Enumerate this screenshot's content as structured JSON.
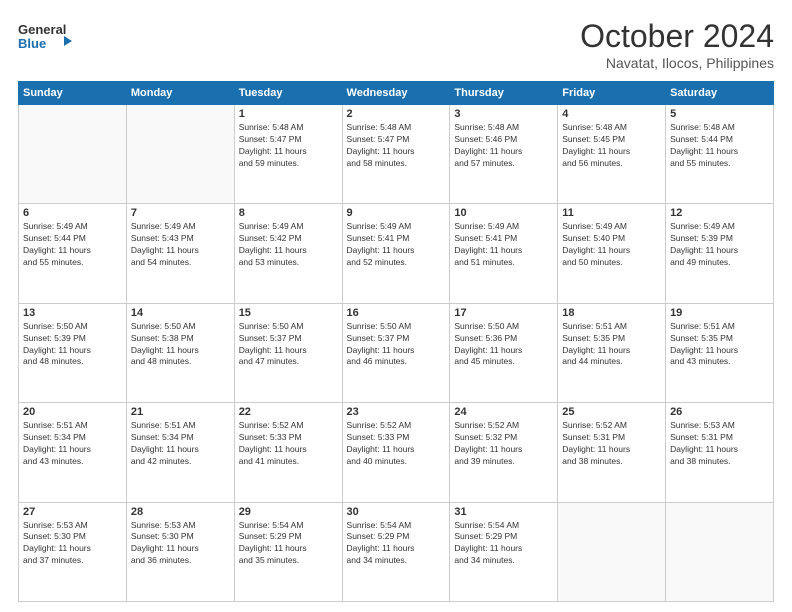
{
  "header": {
    "logo_line1": "General",
    "logo_line2": "Blue",
    "month": "October 2024",
    "location": "Navatat, Ilocos, Philippines"
  },
  "weekdays": [
    "Sunday",
    "Monday",
    "Tuesday",
    "Wednesday",
    "Thursday",
    "Friday",
    "Saturday"
  ],
  "weeks": [
    [
      {
        "day": "",
        "info": ""
      },
      {
        "day": "",
        "info": ""
      },
      {
        "day": "1",
        "info": "Sunrise: 5:48 AM\nSunset: 5:47 PM\nDaylight: 11 hours\nand 59 minutes."
      },
      {
        "day": "2",
        "info": "Sunrise: 5:48 AM\nSunset: 5:47 PM\nDaylight: 11 hours\nand 58 minutes."
      },
      {
        "day": "3",
        "info": "Sunrise: 5:48 AM\nSunset: 5:46 PM\nDaylight: 11 hours\nand 57 minutes."
      },
      {
        "day": "4",
        "info": "Sunrise: 5:48 AM\nSunset: 5:45 PM\nDaylight: 11 hours\nand 56 minutes."
      },
      {
        "day": "5",
        "info": "Sunrise: 5:48 AM\nSunset: 5:44 PM\nDaylight: 11 hours\nand 55 minutes."
      }
    ],
    [
      {
        "day": "6",
        "info": "Sunrise: 5:49 AM\nSunset: 5:44 PM\nDaylight: 11 hours\nand 55 minutes."
      },
      {
        "day": "7",
        "info": "Sunrise: 5:49 AM\nSunset: 5:43 PM\nDaylight: 11 hours\nand 54 minutes."
      },
      {
        "day": "8",
        "info": "Sunrise: 5:49 AM\nSunset: 5:42 PM\nDaylight: 11 hours\nand 53 minutes."
      },
      {
        "day": "9",
        "info": "Sunrise: 5:49 AM\nSunset: 5:41 PM\nDaylight: 11 hours\nand 52 minutes."
      },
      {
        "day": "10",
        "info": "Sunrise: 5:49 AM\nSunset: 5:41 PM\nDaylight: 11 hours\nand 51 minutes."
      },
      {
        "day": "11",
        "info": "Sunrise: 5:49 AM\nSunset: 5:40 PM\nDaylight: 11 hours\nand 50 minutes."
      },
      {
        "day": "12",
        "info": "Sunrise: 5:49 AM\nSunset: 5:39 PM\nDaylight: 11 hours\nand 49 minutes."
      }
    ],
    [
      {
        "day": "13",
        "info": "Sunrise: 5:50 AM\nSunset: 5:39 PM\nDaylight: 11 hours\nand 48 minutes."
      },
      {
        "day": "14",
        "info": "Sunrise: 5:50 AM\nSunset: 5:38 PM\nDaylight: 11 hours\nand 48 minutes."
      },
      {
        "day": "15",
        "info": "Sunrise: 5:50 AM\nSunset: 5:37 PM\nDaylight: 11 hours\nand 47 minutes."
      },
      {
        "day": "16",
        "info": "Sunrise: 5:50 AM\nSunset: 5:37 PM\nDaylight: 11 hours\nand 46 minutes."
      },
      {
        "day": "17",
        "info": "Sunrise: 5:50 AM\nSunset: 5:36 PM\nDaylight: 11 hours\nand 45 minutes."
      },
      {
        "day": "18",
        "info": "Sunrise: 5:51 AM\nSunset: 5:35 PM\nDaylight: 11 hours\nand 44 minutes."
      },
      {
        "day": "19",
        "info": "Sunrise: 5:51 AM\nSunset: 5:35 PM\nDaylight: 11 hours\nand 43 minutes."
      }
    ],
    [
      {
        "day": "20",
        "info": "Sunrise: 5:51 AM\nSunset: 5:34 PM\nDaylight: 11 hours\nand 43 minutes."
      },
      {
        "day": "21",
        "info": "Sunrise: 5:51 AM\nSunset: 5:34 PM\nDaylight: 11 hours\nand 42 minutes."
      },
      {
        "day": "22",
        "info": "Sunrise: 5:52 AM\nSunset: 5:33 PM\nDaylight: 11 hours\nand 41 minutes."
      },
      {
        "day": "23",
        "info": "Sunrise: 5:52 AM\nSunset: 5:33 PM\nDaylight: 11 hours\nand 40 minutes."
      },
      {
        "day": "24",
        "info": "Sunrise: 5:52 AM\nSunset: 5:32 PM\nDaylight: 11 hours\nand 39 minutes."
      },
      {
        "day": "25",
        "info": "Sunrise: 5:52 AM\nSunset: 5:31 PM\nDaylight: 11 hours\nand 38 minutes."
      },
      {
        "day": "26",
        "info": "Sunrise: 5:53 AM\nSunset: 5:31 PM\nDaylight: 11 hours\nand 38 minutes."
      }
    ],
    [
      {
        "day": "27",
        "info": "Sunrise: 5:53 AM\nSunset: 5:30 PM\nDaylight: 11 hours\nand 37 minutes."
      },
      {
        "day": "28",
        "info": "Sunrise: 5:53 AM\nSunset: 5:30 PM\nDaylight: 11 hours\nand 36 minutes."
      },
      {
        "day": "29",
        "info": "Sunrise: 5:54 AM\nSunset: 5:29 PM\nDaylight: 11 hours\nand 35 minutes."
      },
      {
        "day": "30",
        "info": "Sunrise: 5:54 AM\nSunset: 5:29 PM\nDaylight: 11 hours\nand 34 minutes."
      },
      {
        "day": "31",
        "info": "Sunrise: 5:54 AM\nSunset: 5:29 PM\nDaylight: 11 hours\nand 34 minutes."
      },
      {
        "day": "",
        "info": ""
      },
      {
        "day": "",
        "info": ""
      }
    ]
  ]
}
